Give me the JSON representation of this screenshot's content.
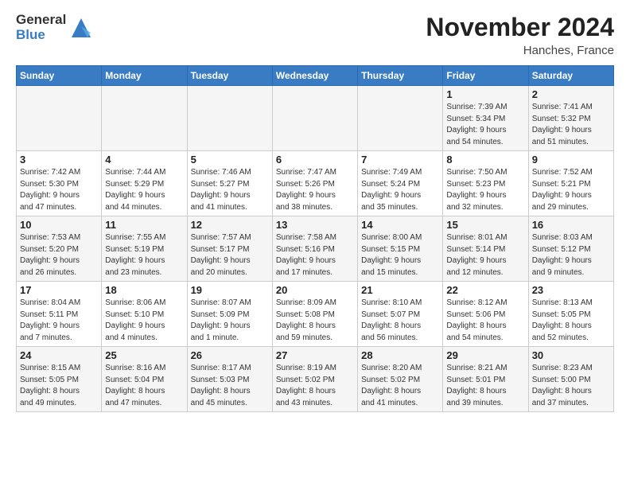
{
  "logo": {
    "general": "General",
    "blue": "Blue"
  },
  "title": "November 2024",
  "location": "Hanches, France",
  "days_header": [
    "Sunday",
    "Monday",
    "Tuesday",
    "Wednesday",
    "Thursday",
    "Friday",
    "Saturday"
  ],
  "weeks": [
    [
      {
        "day": "",
        "info": ""
      },
      {
        "day": "",
        "info": ""
      },
      {
        "day": "",
        "info": ""
      },
      {
        "day": "",
        "info": ""
      },
      {
        "day": "",
        "info": ""
      },
      {
        "day": "1",
        "info": "Sunrise: 7:39 AM\nSunset: 5:34 PM\nDaylight: 9 hours\nand 54 minutes."
      },
      {
        "day": "2",
        "info": "Sunrise: 7:41 AM\nSunset: 5:32 PM\nDaylight: 9 hours\nand 51 minutes."
      }
    ],
    [
      {
        "day": "3",
        "info": "Sunrise: 7:42 AM\nSunset: 5:30 PM\nDaylight: 9 hours\nand 47 minutes."
      },
      {
        "day": "4",
        "info": "Sunrise: 7:44 AM\nSunset: 5:29 PM\nDaylight: 9 hours\nand 44 minutes."
      },
      {
        "day": "5",
        "info": "Sunrise: 7:46 AM\nSunset: 5:27 PM\nDaylight: 9 hours\nand 41 minutes."
      },
      {
        "day": "6",
        "info": "Sunrise: 7:47 AM\nSunset: 5:26 PM\nDaylight: 9 hours\nand 38 minutes."
      },
      {
        "day": "7",
        "info": "Sunrise: 7:49 AM\nSunset: 5:24 PM\nDaylight: 9 hours\nand 35 minutes."
      },
      {
        "day": "8",
        "info": "Sunrise: 7:50 AM\nSunset: 5:23 PM\nDaylight: 9 hours\nand 32 minutes."
      },
      {
        "day": "9",
        "info": "Sunrise: 7:52 AM\nSunset: 5:21 PM\nDaylight: 9 hours\nand 29 minutes."
      }
    ],
    [
      {
        "day": "10",
        "info": "Sunrise: 7:53 AM\nSunset: 5:20 PM\nDaylight: 9 hours\nand 26 minutes."
      },
      {
        "day": "11",
        "info": "Sunrise: 7:55 AM\nSunset: 5:19 PM\nDaylight: 9 hours\nand 23 minutes."
      },
      {
        "day": "12",
        "info": "Sunrise: 7:57 AM\nSunset: 5:17 PM\nDaylight: 9 hours\nand 20 minutes."
      },
      {
        "day": "13",
        "info": "Sunrise: 7:58 AM\nSunset: 5:16 PM\nDaylight: 9 hours\nand 17 minutes."
      },
      {
        "day": "14",
        "info": "Sunrise: 8:00 AM\nSunset: 5:15 PM\nDaylight: 9 hours\nand 15 minutes."
      },
      {
        "day": "15",
        "info": "Sunrise: 8:01 AM\nSunset: 5:14 PM\nDaylight: 9 hours\nand 12 minutes."
      },
      {
        "day": "16",
        "info": "Sunrise: 8:03 AM\nSunset: 5:12 PM\nDaylight: 9 hours\nand 9 minutes."
      }
    ],
    [
      {
        "day": "17",
        "info": "Sunrise: 8:04 AM\nSunset: 5:11 PM\nDaylight: 9 hours\nand 7 minutes."
      },
      {
        "day": "18",
        "info": "Sunrise: 8:06 AM\nSunset: 5:10 PM\nDaylight: 9 hours\nand 4 minutes."
      },
      {
        "day": "19",
        "info": "Sunrise: 8:07 AM\nSunset: 5:09 PM\nDaylight: 9 hours\nand 1 minute."
      },
      {
        "day": "20",
        "info": "Sunrise: 8:09 AM\nSunset: 5:08 PM\nDaylight: 8 hours\nand 59 minutes."
      },
      {
        "day": "21",
        "info": "Sunrise: 8:10 AM\nSunset: 5:07 PM\nDaylight: 8 hours\nand 56 minutes."
      },
      {
        "day": "22",
        "info": "Sunrise: 8:12 AM\nSunset: 5:06 PM\nDaylight: 8 hours\nand 54 minutes."
      },
      {
        "day": "23",
        "info": "Sunrise: 8:13 AM\nSunset: 5:05 PM\nDaylight: 8 hours\nand 52 minutes."
      }
    ],
    [
      {
        "day": "24",
        "info": "Sunrise: 8:15 AM\nSunset: 5:05 PM\nDaylight: 8 hours\nand 49 minutes."
      },
      {
        "day": "25",
        "info": "Sunrise: 8:16 AM\nSunset: 5:04 PM\nDaylight: 8 hours\nand 47 minutes."
      },
      {
        "day": "26",
        "info": "Sunrise: 8:17 AM\nSunset: 5:03 PM\nDaylight: 8 hours\nand 45 minutes."
      },
      {
        "day": "27",
        "info": "Sunrise: 8:19 AM\nSunset: 5:02 PM\nDaylight: 8 hours\nand 43 minutes."
      },
      {
        "day": "28",
        "info": "Sunrise: 8:20 AM\nSunset: 5:02 PM\nDaylight: 8 hours\nand 41 minutes."
      },
      {
        "day": "29",
        "info": "Sunrise: 8:21 AM\nSunset: 5:01 PM\nDaylight: 8 hours\nand 39 minutes."
      },
      {
        "day": "30",
        "info": "Sunrise: 8:23 AM\nSunset: 5:00 PM\nDaylight: 8 hours\nand 37 minutes."
      }
    ]
  ]
}
